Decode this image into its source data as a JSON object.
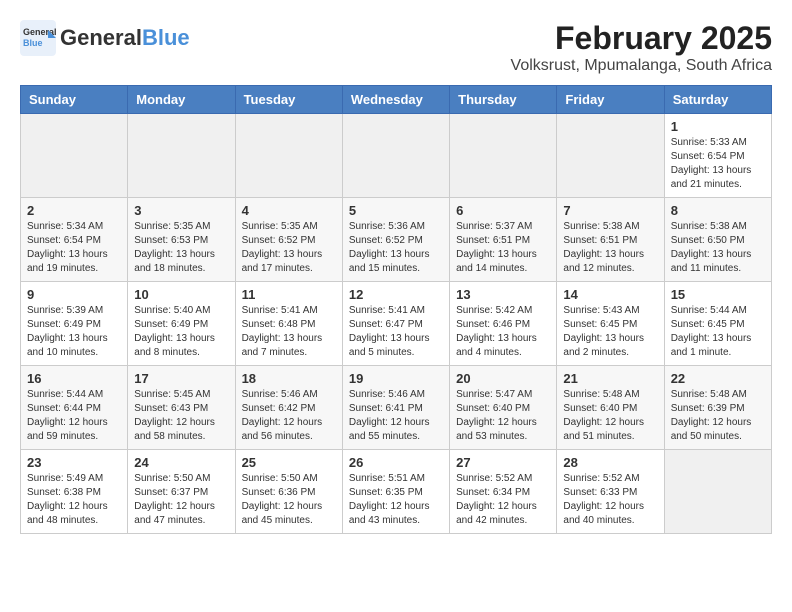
{
  "header": {
    "logo_general": "General",
    "logo_blue": "Blue",
    "month": "February 2025",
    "location": "Volksrust, Mpumalanga, South Africa"
  },
  "days_of_week": [
    "Sunday",
    "Monday",
    "Tuesday",
    "Wednesday",
    "Thursday",
    "Friday",
    "Saturday"
  ],
  "weeks": [
    [
      {
        "day": "",
        "info": ""
      },
      {
        "day": "",
        "info": ""
      },
      {
        "day": "",
        "info": ""
      },
      {
        "day": "",
        "info": ""
      },
      {
        "day": "",
        "info": ""
      },
      {
        "day": "",
        "info": ""
      },
      {
        "day": "1",
        "info": "Sunrise: 5:33 AM\nSunset: 6:54 PM\nDaylight: 13 hours\nand 21 minutes."
      }
    ],
    [
      {
        "day": "2",
        "info": "Sunrise: 5:34 AM\nSunset: 6:54 PM\nDaylight: 13 hours\nand 19 minutes."
      },
      {
        "day": "3",
        "info": "Sunrise: 5:35 AM\nSunset: 6:53 PM\nDaylight: 13 hours\nand 18 minutes."
      },
      {
        "day": "4",
        "info": "Sunrise: 5:35 AM\nSunset: 6:52 PM\nDaylight: 13 hours\nand 17 minutes."
      },
      {
        "day": "5",
        "info": "Sunrise: 5:36 AM\nSunset: 6:52 PM\nDaylight: 13 hours\nand 15 minutes."
      },
      {
        "day": "6",
        "info": "Sunrise: 5:37 AM\nSunset: 6:51 PM\nDaylight: 13 hours\nand 14 minutes."
      },
      {
        "day": "7",
        "info": "Sunrise: 5:38 AM\nSunset: 6:51 PM\nDaylight: 13 hours\nand 12 minutes."
      },
      {
        "day": "8",
        "info": "Sunrise: 5:38 AM\nSunset: 6:50 PM\nDaylight: 13 hours\nand 11 minutes."
      }
    ],
    [
      {
        "day": "9",
        "info": "Sunrise: 5:39 AM\nSunset: 6:49 PM\nDaylight: 13 hours\nand 10 minutes."
      },
      {
        "day": "10",
        "info": "Sunrise: 5:40 AM\nSunset: 6:49 PM\nDaylight: 13 hours\nand 8 minutes."
      },
      {
        "day": "11",
        "info": "Sunrise: 5:41 AM\nSunset: 6:48 PM\nDaylight: 13 hours\nand 7 minutes."
      },
      {
        "day": "12",
        "info": "Sunrise: 5:41 AM\nSunset: 6:47 PM\nDaylight: 13 hours\nand 5 minutes."
      },
      {
        "day": "13",
        "info": "Sunrise: 5:42 AM\nSunset: 6:46 PM\nDaylight: 13 hours\nand 4 minutes."
      },
      {
        "day": "14",
        "info": "Sunrise: 5:43 AM\nSunset: 6:45 PM\nDaylight: 13 hours\nand 2 minutes."
      },
      {
        "day": "15",
        "info": "Sunrise: 5:44 AM\nSunset: 6:45 PM\nDaylight: 13 hours\nand 1 minute."
      }
    ],
    [
      {
        "day": "16",
        "info": "Sunrise: 5:44 AM\nSunset: 6:44 PM\nDaylight: 12 hours\nand 59 minutes."
      },
      {
        "day": "17",
        "info": "Sunrise: 5:45 AM\nSunset: 6:43 PM\nDaylight: 12 hours\nand 58 minutes."
      },
      {
        "day": "18",
        "info": "Sunrise: 5:46 AM\nSunset: 6:42 PM\nDaylight: 12 hours\nand 56 minutes."
      },
      {
        "day": "19",
        "info": "Sunrise: 5:46 AM\nSunset: 6:41 PM\nDaylight: 12 hours\nand 55 minutes."
      },
      {
        "day": "20",
        "info": "Sunrise: 5:47 AM\nSunset: 6:40 PM\nDaylight: 12 hours\nand 53 minutes."
      },
      {
        "day": "21",
        "info": "Sunrise: 5:48 AM\nSunset: 6:40 PM\nDaylight: 12 hours\nand 51 minutes."
      },
      {
        "day": "22",
        "info": "Sunrise: 5:48 AM\nSunset: 6:39 PM\nDaylight: 12 hours\nand 50 minutes."
      }
    ],
    [
      {
        "day": "23",
        "info": "Sunrise: 5:49 AM\nSunset: 6:38 PM\nDaylight: 12 hours\nand 48 minutes."
      },
      {
        "day": "24",
        "info": "Sunrise: 5:50 AM\nSunset: 6:37 PM\nDaylight: 12 hours\nand 47 minutes."
      },
      {
        "day": "25",
        "info": "Sunrise: 5:50 AM\nSunset: 6:36 PM\nDaylight: 12 hours\nand 45 minutes."
      },
      {
        "day": "26",
        "info": "Sunrise: 5:51 AM\nSunset: 6:35 PM\nDaylight: 12 hours\nand 43 minutes."
      },
      {
        "day": "27",
        "info": "Sunrise: 5:52 AM\nSunset: 6:34 PM\nDaylight: 12 hours\nand 42 minutes."
      },
      {
        "day": "28",
        "info": "Sunrise: 5:52 AM\nSunset: 6:33 PM\nDaylight: 12 hours\nand 40 minutes."
      },
      {
        "day": "",
        "info": ""
      }
    ]
  ]
}
